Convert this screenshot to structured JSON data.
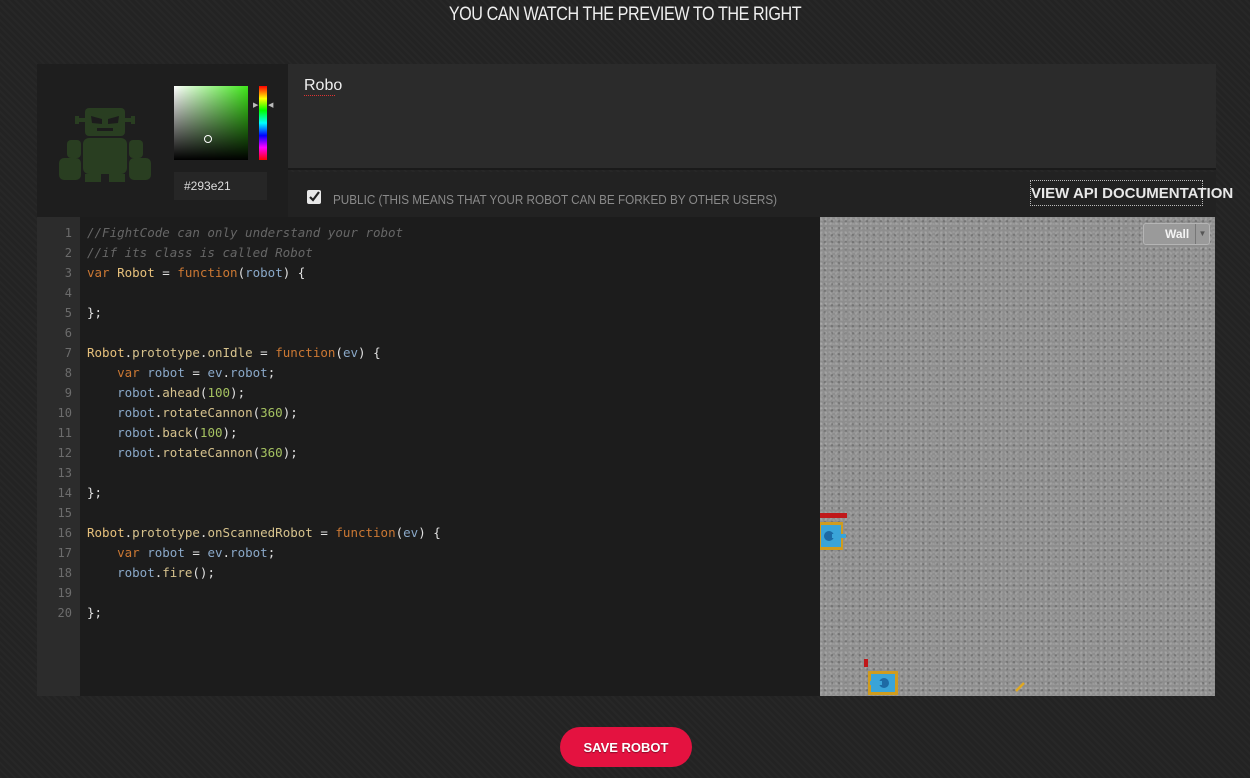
{
  "header": {
    "title": "YOU CAN WATCH THE PREVIEW TO THE RIGHT"
  },
  "robot": {
    "color_hex": "#293e21",
    "color_picker": {
      "hue_color": "#3fe61a"
    },
    "name": "Robo"
  },
  "options": {
    "public_checked": true,
    "public_label": "PUBLIC (THIS MEANS THAT YOUR ROBOT CAN BE FORKED BY OTHER USERS)",
    "api_doc_label": "VIEW API DOCUMENTATION"
  },
  "editor": {
    "lines": [
      "//FightCode can only understand your robot",
      "//if its class is called Robot",
      "var Robot = function(robot) {",
      "",
      "};",
      "",
      "Robot.prototype.onIdle = function(ev) {",
      "    var robot = ev.robot;",
      "    robot.ahead(100);",
      "    robot.rotateCannon(360);",
      "    robot.back(100);",
      "    robot.rotateCannon(360);",
      "",
      "};",
      "",
      "Robot.prototype.onScannedRobot = function(ev) {",
      "    var robot = ev.robot;",
      "    robot.fire();",
      "",
      "};"
    ]
  },
  "preview": {
    "arena_select_value": "Wall"
  },
  "actions": {
    "save_label": "SAVE ROBOT"
  }
}
